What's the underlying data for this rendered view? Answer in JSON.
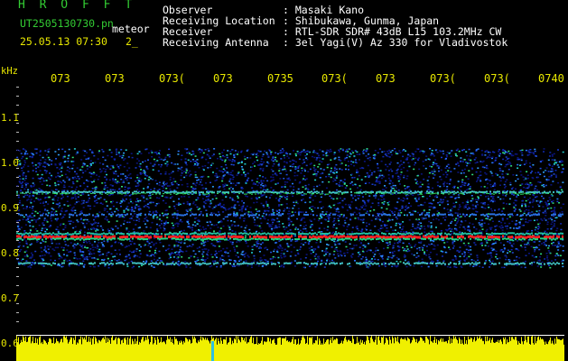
{
  "header": {
    "brand": "H R O F F T",
    "filename": "UT2505130730.pn",
    "meteor_label": "meteor",
    "datetime": "25.05.13 07:30",
    "count": "2_"
  },
  "station": {
    "observer_label": "Observer",
    "observer_value": "Masaki Kano",
    "location_label": "Receiving Location",
    "location_value": "Shibukawa, Gunma, Japan",
    "receiver_label": "Receiver",
    "receiver_value": "RTL-SDR SDR# 43dB L15 103.2MHz CW",
    "antenna_label": "Receiving Antenna",
    "antenna_value": "3el Yagi(V) Az 330 for Vladivostok"
  },
  "axis": {
    "y_unit": "kHz",
    "time_ticks": [
      "073",
      "073",
      "073(",
      "073",
      "0735",
      "073(",
      "073",
      "073(",
      "073(",
      "0740"
    ],
    "freq_ticks": [
      "1.1",
      "1.0",
      "0.9",
      "0.8",
      "0.7",
      "0.6"
    ]
  },
  "colors": {
    "background": "#000000",
    "label_green": "#33cc33",
    "label_yellow": "#e8e800",
    "text_white": "#ffffff",
    "echo_red": "#ff2020",
    "noise_blue": "#2030c0",
    "amplitude_fill": "#f0f000"
  }
}
